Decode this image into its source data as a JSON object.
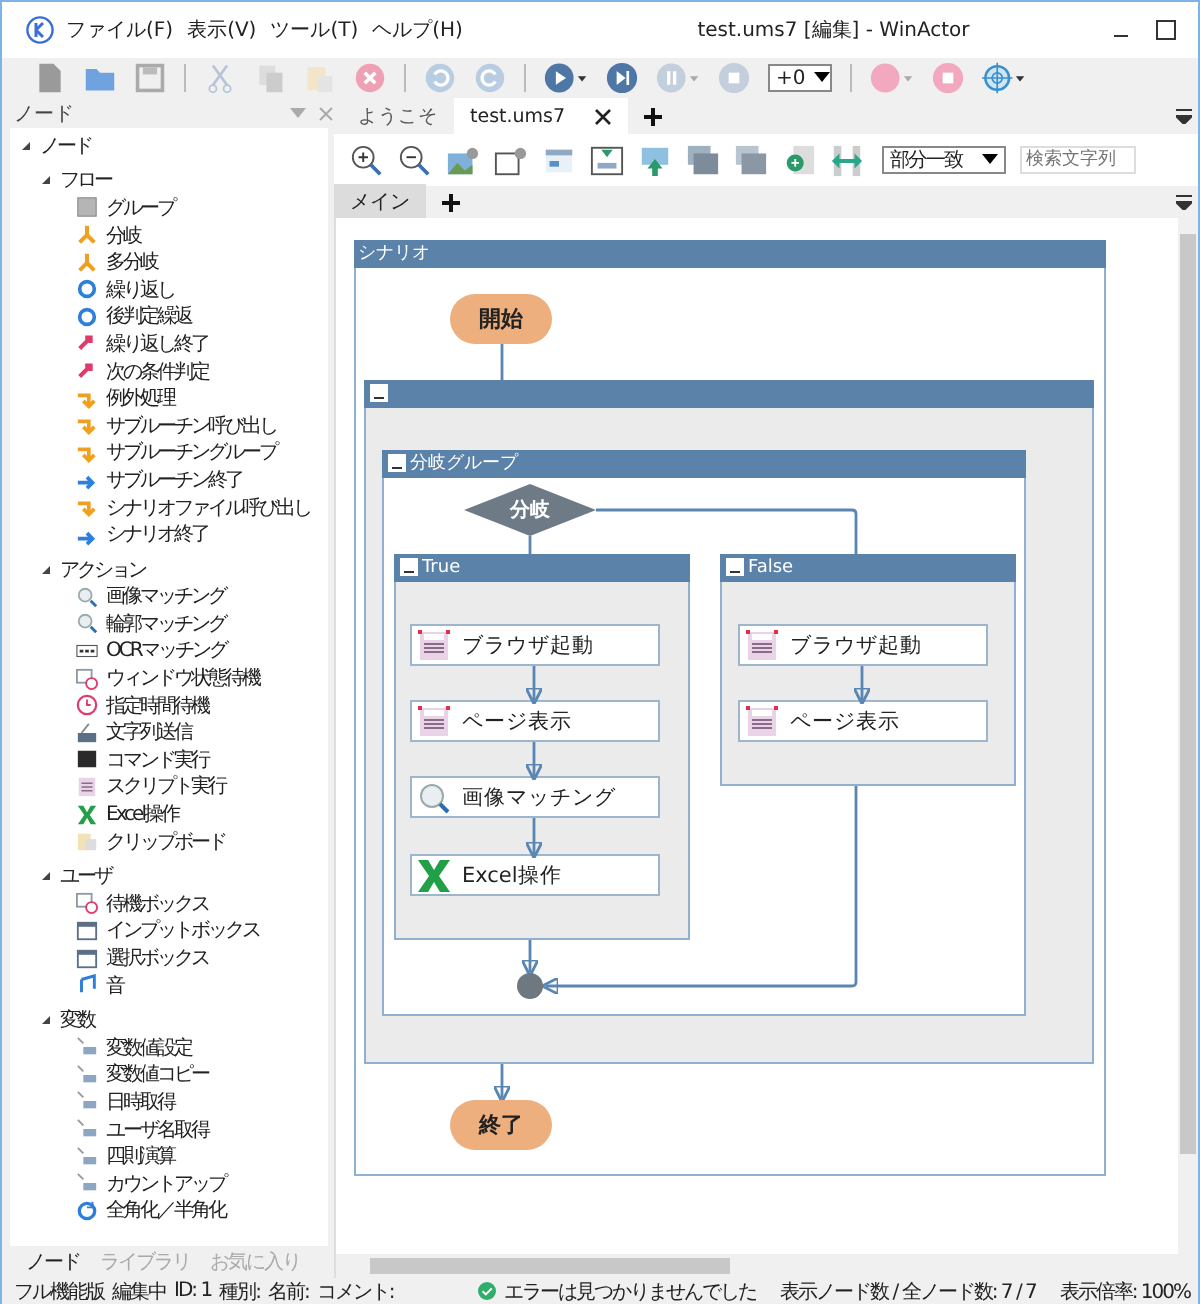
{
  "window": {
    "title": "test.ums7 [編集] - WinActor"
  },
  "menu": [
    "ファイル(F)",
    "表示(V)",
    "ツール(T)",
    "ヘルプ(H)"
  ],
  "toolbar": {
    "speed": "+0"
  },
  "node_panel": {
    "title": "ノード",
    "tree": [
      {
        "label": "ノード",
        "expanded": true,
        "children": [
          {
            "label": "フロー",
            "expanded": true,
            "children": [
              {
                "label": "グループ",
                "kind": "group"
              },
              {
                "label": "分岐",
                "kind": "fork"
              },
              {
                "label": "多分岐",
                "kind": "fork"
              },
              {
                "label": "繰り返し",
                "kind": "loop"
              },
              {
                "label": "後判定繰返",
                "kind": "loop"
              },
              {
                "label": "繰り返し終了",
                "kind": "jump"
              },
              {
                "label": "次の条件判定",
                "kind": "jump"
              },
              {
                "label": "例外処理",
                "kind": "orange-arrow"
              },
              {
                "label": "サブルーチン呼び出し",
                "kind": "orange-arrow"
              },
              {
                "label": "サブルーチングループ",
                "kind": "orange-arrow"
              },
              {
                "label": "サブルーチン終了",
                "kind": "blue-arrow"
              },
              {
                "label": "シナリオファイル呼び出し",
                "kind": "orange-arrow"
              },
              {
                "label": "シナリオ終了",
                "kind": "blue-arrow"
              }
            ]
          },
          {
            "label": "アクション",
            "expanded": true,
            "children": [
              {
                "label": "画像マッチング",
                "kind": "magnifier"
              },
              {
                "label": "輪郭マッチング",
                "kind": "magnifier"
              },
              {
                "label": "OCRマッチング",
                "kind": "ocr"
              },
              {
                "label": "ウィンドウ状態待機",
                "kind": "window-clock"
              },
              {
                "label": "指定時間待機",
                "kind": "clock"
              },
              {
                "label": "文字列送信",
                "kind": "keyboard"
              },
              {
                "label": "コマンド実行",
                "kind": "terminal"
              },
              {
                "label": "スクリプト実行",
                "kind": "script"
              },
              {
                "label": "Excel操作",
                "kind": "excel"
              },
              {
                "label": "クリップボード",
                "kind": "clipboard"
              }
            ]
          },
          {
            "label": "ユーザ",
            "expanded": true,
            "children": [
              {
                "label": "待機ボックス",
                "kind": "window-clock"
              },
              {
                "label": "インプットボックス",
                "kind": "window"
              },
              {
                "label": "選択ボックス",
                "kind": "window"
              },
              {
                "label": "音",
                "kind": "music"
              }
            ]
          },
          {
            "label": "変数",
            "expanded": true,
            "children": [
              {
                "label": "変数値設定",
                "kind": "variable"
              },
              {
                "label": "変数値コピー",
                "kind": "variable"
              },
              {
                "label": "日時取得",
                "kind": "variable"
              },
              {
                "label": "ユーザ名取得",
                "kind": "variable"
              },
              {
                "label": "四則演算",
                "kind": "variable"
              },
              {
                "label": "カウントアップ",
                "kind": "variable"
              },
              {
                "label": "全角化／半角化",
                "kind": "convert"
              }
            ]
          }
        ]
      }
    ],
    "tabs": [
      {
        "label": "ノード",
        "selected": true
      },
      {
        "label": "ライブラリ",
        "selected": false
      },
      {
        "label": "お気に入り",
        "selected": false
      }
    ]
  },
  "doc_tabs": [
    {
      "label": "ようこそ",
      "selected": false
    },
    {
      "label": "test.ums7",
      "selected": true
    }
  ],
  "editor_toolbar": {
    "match_mode": "部分一致",
    "search_placeholder": "検索文字列"
  },
  "sheet_tabs": [
    {
      "label": "メイン",
      "selected": true
    }
  ],
  "flow": {
    "scenario_title": "シナリオ",
    "start": "開始",
    "end": "終了",
    "branch_group_title": "分岐グループ",
    "branch": "分岐",
    "true_branch": {
      "title": "True",
      "nodes": [
        {
          "label": "ブラウザ起動",
          "kind": "script"
        },
        {
          "label": "ページ表示",
          "kind": "script"
        },
        {
          "label": "画像マッチング",
          "kind": "magnifier"
        },
        {
          "label": "Excel操作",
          "kind": "excel"
        }
      ]
    },
    "false_branch": {
      "title": "False",
      "nodes": [
        {
          "label": "ブラウザ起動",
          "kind": "script"
        },
        {
          "label": "ページ表示",
          "kind": "script"
        }
      ]
    }
  },
  "status_bar": {
    "edition": "フル機能版",
    "mode": "編集中",
    "id": "ID: 1",
    "type": "種別:",
    "name": "名前:",
    "comment": "コメント:",
    "check": "エラーは見つかりませんでした",
    "node_count": "表示ノード数 / 全ノード数: 7 / 7",
    "zoom": "表示倍率: 100%"
  }
}
